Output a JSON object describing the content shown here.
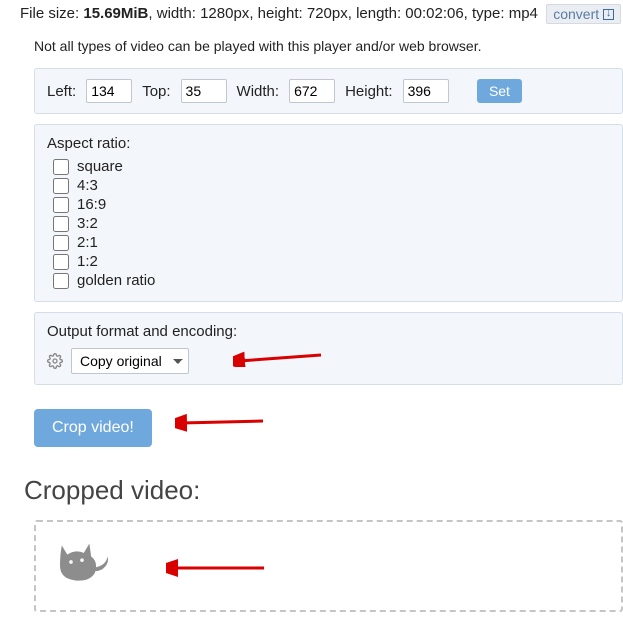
{
  "file": {
    "size_label": "File size: ",
    "size_value": "15.69MiB",
    "width_label": ", width: ",
    "width_value": "1280px",
    "height_label": ", height: ",
    "height_value": "720px",
    "length_label": ", length: ",
    "length_value": "00:02:06",
    "type_label": ", type: ",
    "type_value": "mp4",
    "convert_label": "convert"
  },
  "note": "Not all types of video can be played with this player and/or web browser.",
  "crop": {
    "left_label": "Left:",
    "left_value": "134",
    "top_label": "Top:",
    "top_value": "35",
    "width_label": "Width:",
    "width_value": "672",
    "height_label": "Height:",
    "height_value": "396",
    "set_label": "Set"
  },
  "aspect": {
    "title": "Aspect ratio:",
    "items": [
      "square",
      "4:3",
      "16:9",
      "3:2",
      "2:1",
      "1:2",
      "golden ratio"
    ]
  },
  "output": {
    "title": "Output format and encoding:",
    "selected": "Copy original"
  },
  "actions": {
    "crop_button": "Crop video!"
  },
  "result": {
    "heading": "Cropped video:"
  }
}
